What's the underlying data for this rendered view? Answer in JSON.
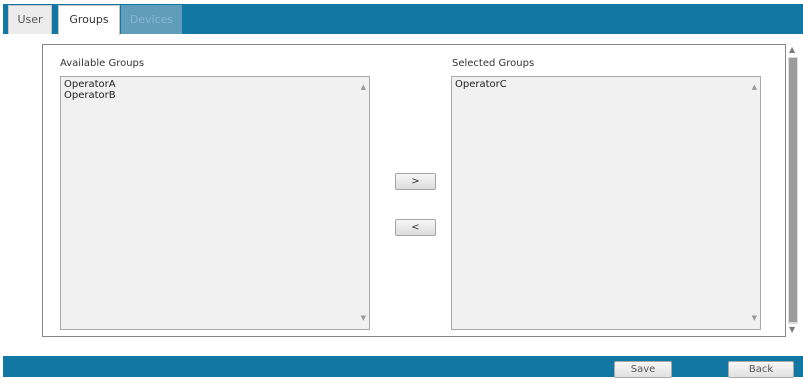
{
  "tabs": [
    {
      "label": "User",
      "state": "inactive"
    },
    {
      "label": "Groups",
      "state": "active"
    },
    {
      "label": "Devices",
      "state": "disabled"
    }
  ],
  "available": {
    "label": "Available Groups",
    "items": [
      "OperatorA",
      "OperatorB"
    ]
  },
  "selected": {
    "label": "Selected Groups",
    "items": [
      "OperatorC"
    ]
  },
  "move": {
    "add_label": ">",
    "remove_label": "<"
  },
  "footer": {
    "save_label": "Save",
    "back_label": "Back"
  },
  "icons": {
    "scroll_up": "triangle-up",
    "scroll_down": "triangle-down"
  },
  "colors": {
    "header_bar": "#1277a2",
    "disabled_tab": "#5f9dbb",
    "listbox_bg": "#f1f1f1"
  }
}
